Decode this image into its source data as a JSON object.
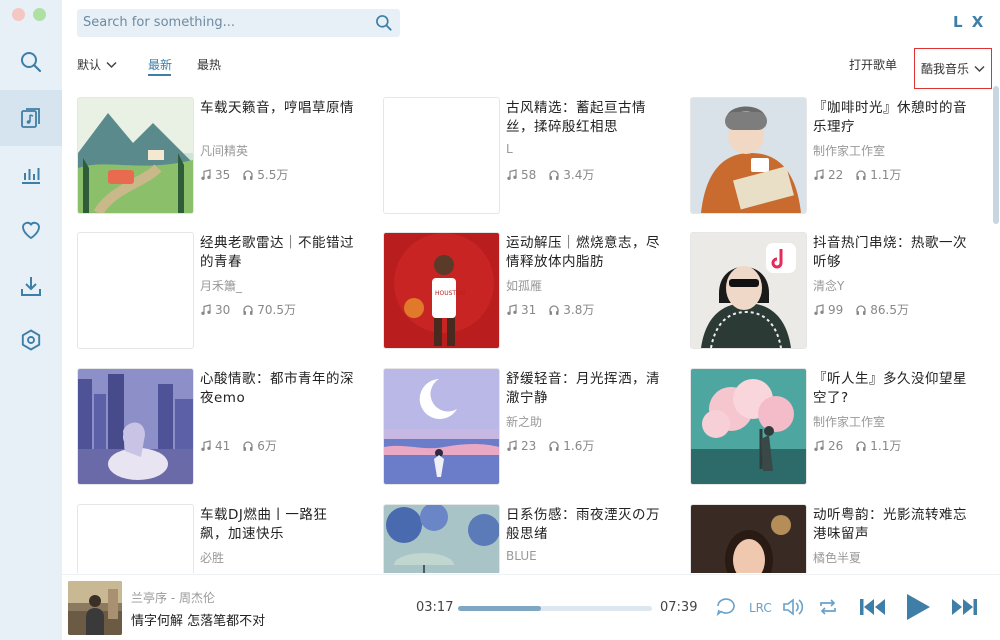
{
  "app": {
    "logo": "L X"
  },
  "colors": {
    "accent": "#3f7ea6",
    "sidebar_bg": "#e7f0f7",
    "highlight_border": "#dd3333"
  },
  "search": {
    "placeholder": "Search for something..."
  },
  "sidebar": {
    "items": [
      {
        "icon": "search-icon",
        "active": false
      },
      {
        "icon": "playlist-icon",
        "active": true
      },
      {
        "icon": "chart-icon",
        "active": false
      },
      {
        "icon": "heart-icon",
        "active": false
      },
      {
        "icon": "download-icon",
        "active": false
      },
      {
        "icon": "settings-icon",
        "active": false
      }
    ]
  },
  "filters": {
    "sort_label": "默认",
    "tabs": [
      {
        "label": "最新",
        "active": true
      },
      {
        "label": "最热",
        "active": false
      }
    ],
    "open_playlist": "打开歌单",
    "source": "酷我音乐"
  },
  "playlists": [
    {
      "title": "车载天籁音，哼唱草原情",
      "author": "凡间精英",
      "songs": "35",
      "plays": "5.5万",
      "cover": "meadow"
    },
    {
      "title": "古风精选：蓄起亘古情丝，揉碎殷红相思",
      "author": "L",
      "songs": "58",
      "plays": "3.4万",
      "cover": "blank"
    },
    {
      "title": "『咖啡时光』休憩时的音乐理疗",
      "author": "制作家工作室",
      "songs": "22",
      "plays": "1.1万",
      "cover": "coffee"
    },
    {
      "title": "经典老歌雷达｜不能错过的青春",
      "author": "月禾簫_",
      "songs": "30",
      "plays": "70.5万",
      "cover": "blank"
    },
    {
      "title": "运动解压｜燃烧意志，尽情释放体内脂肪",
      "author": "如孤雁",
      "songs": "31",
      "plays": "3.8万",
      "cover": "basketball"
    },
    {
      "title": "抖音热门串烧：热歌一次听够",
      "author": "清念Y",
      "songs": "99",
      "plays": "86.5万",
      "cover": "tiktok"
    },
    {
      "title": "心酸情歌：都市青年的深夜emo",
      "author": "",
      "songs": "41",
      "plays": "6万",
      "cover": "city"
    },
    {
      "title": "舒缓轻音：月光挥洒，清澈宁静",
      "author": "新之助",
      "songs": "23",
      "plays": "1.6万",
      "cover": "moon"
    },
    {
      "title": "『听人生』多久没仰望星空了?",
      "author": "制作家工作室",
      "songs": "26",
      "plays": "1.1万",
      "cover": "clouds"
    },
    {
      "title": "车载DJ燃曲丨一路狂飙，加速快乐",
      "author": "必胜",
      "songs": "",
      "plays": "",
      "cover": "blank"
    },
    {
      "title": "日系伤感：雨夜湮灭の万般思绪",
      "author": "BLUE",
      "songs": "",
      "plays": "",
      "cover": "rain"
    },
    {
      "title": "动听粤韵：光影流转难忘港味留声",
      "author": "橘色半夏",
      "songs": "",
      "plays": "",
      "cover": "hk"
    }
  ],
  "player": {
    "song": "兰亭序 - 周杰伦",
    "lyric": "情字何解 怎落笔都不对",
    "current_time": "03:17",
    "total_time": "07:39",
    "progress": 0.43,
    "lrc_label": "LRC"
  }
}
